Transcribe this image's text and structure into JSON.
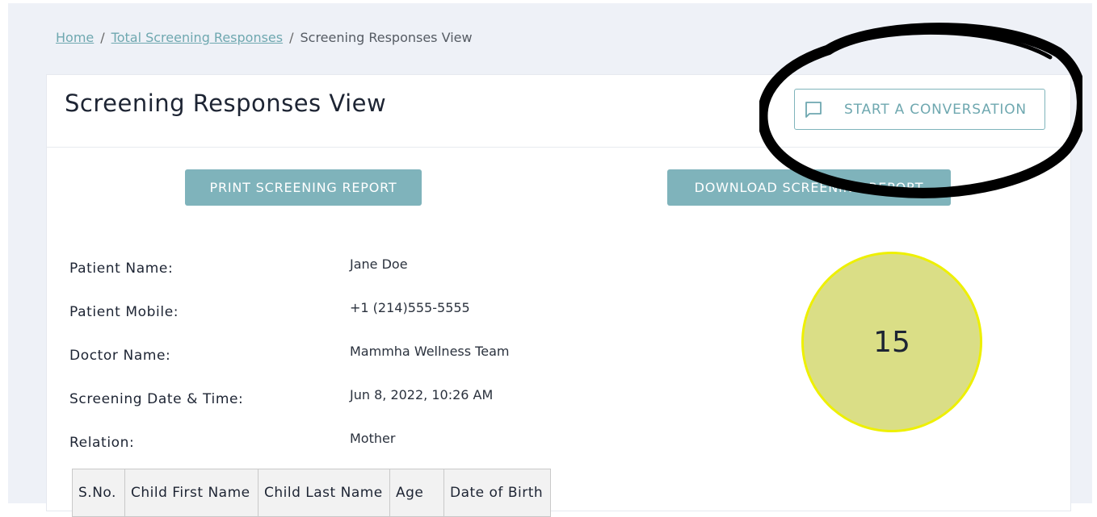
{
  "breadcrumb": {
    "home": "Home",
    "total_responses": "Total Screening Responses",
    "current": "Screening Responses View",
    "separator": "/"
  },
  "header": {
    "title": "Screening Responses View",
    "conversation_button": "START A CONVERSATION",
    "conversation_icon": "chat-bubble-icon"
  },
  "actions": {
    "print_label": "PRINT SCREENING REPORT",
    "download_label": "DOWNLOAD SCREENING REPORT"
  },
  "patient": {
    "name_label": "Patient Name:",
    "name_value": "Jane Doe",
    "mobile_label": "Patient Mobile:",
    "mobile_value": "+1 (214)555-5555",
    "doctor_label": "Doctor Name:",
    "doctor_value": "Mammha Wellness Team",
    "date_label": "Screening Date & Time:",
    "date_value": "Jun 8, 2022, 10:26 AM",
    "relation_label": "Relation:",
    "relation_value": "Mother"
  },
  "score": {
    "value": "15",
    "color": "#dade86",
    "border_color": "#eef000"
  },
  "children_table": {
    "columns": [
      "S.No.",
      "Child First Name",
      "Child Last Name",
      "Age",
      "Date of Birth"
    ]
  },
  "colors": {
    "accent": "#7fb3bb",
    "page_bg": "#eef1f7"
  }
}
